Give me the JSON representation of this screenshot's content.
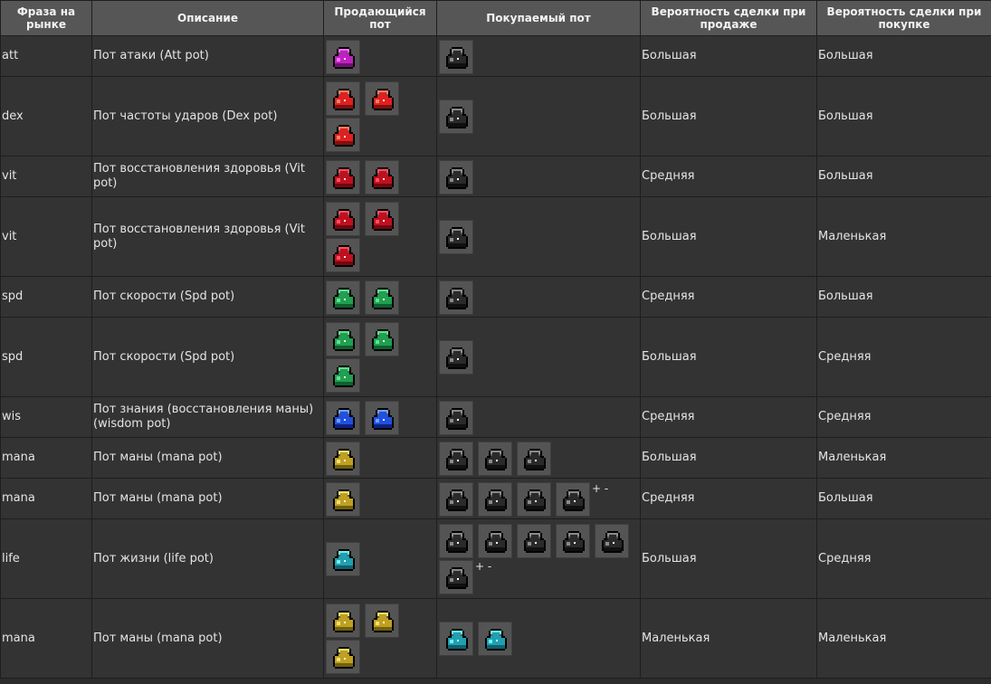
{
  "headers": [
    "Фраза на рынке",
    "Описание",
    "Продающийся пот",
    "Покупаемый пот",
    "Вероятность сделки при продаже",
    "Вероятность сделки при покупке"
  ],
  "rows": [
    {
      "phrase": "att",
      "desc": "Пот атаки (Att pot)",
      "sell": [
        "att-potion-icon"
      ],
      "buy": [
        "empty-potion-icon"
      ],
      "buy_note": "",
      "p_sell": "Большая",
      "p_buy": "Большая"
    },
    {
      "phrase": "dex",
      "desc": "Пот частоты ударов (Dex pot)",
      "sell": [
        "dex-potion-icon",
        "dex-potion-icon",
        "dex-potion-icon"
      ],
      "buy": [
        "empty-potion-icon"
      ],
      "buy_note": "",
      "p_sell": "Большая",
      "p_buy": "Большая"
    },
    {
      "phrase": "vit",
      "desc": "Пот восстановления здоровья (Vit pot)",
      "sell": [
        "vit-potion-icon",
        "vit-potion-icon"
      ],
      "buy": [
        "empty-potion-icon"
      ],
      "buy_note": "",
      "p_sell": "Средняя",
      "p_buy": "Большая"
    },
    {
      "phrase": "vit",
      "desc": "Пот восстановления здоровья (Vit pot)",
      "sell": [
        "vit-potion-icon",
        "vit-potion-icon",
        "vit-potion-icon"
      ],
      "buy": [
        "empty-potion-icon"
      ],
      "buy_note": "",
      "p_sell": "Большая",
      "p_buy": "Маленькая"
    },
    {
      "phrase": "spd",
      "desc": "Пот скорости (Spd pot)",
      "sell": [
        "spd-potion-icon",
        "spd-potion-icon"
      ],
      "buy": [
        "empty-potion-icon"
      ],
      "buy_note": "",
      "p_sell": "Средняя",
      "p_buy": "Большая"
    },
    {
      "phrase": "spd",
      "desc": "Пот скорости (Spd pot)",
      "sell": [
        "spd-potion-icon",
        "spd-potion-icon",
        "spd-potion-icon"
      ],
      "buy": [
        "empty-potion-icon"
      ],
      "buy_note": "",
      "p_sell": "Большая",
      "p_buy": "Средняя"
    },
    {
      "phrase": "wis",
      "desc": "Пот знания (восстановления маны) (wisdom pot)",
      "sell": [
        "wis-potion-icon",
        "wis-potion-icon"
      ],
      "buy": [
        "empty-potion-icon"
      ],
      "buy_note": "",
      "p_sell": "Средняя",
      "p_buy": "Средняя"
    },
    {
      "phrase": "mana",
      "desc": "Пот маны (mana pot)",
      "sell": [
        "mana-potion-icon"
      ],
      "buy": [
        "empty-potion-icon",
        "empty-potion-icon",
        "empty-potion-icon"
      ],
      "buy_note": "",
      "p_sell": "Большая",
      "p_buy": "Маленькая"
    },
    {
      "phrase": "mana",
      "desc": "Пот маны (mana pot)",
      "sell": [
        "mana-potion-icon"
      ],
      "buy": [
        "empty-potion-icon",
        "empty-potion-icon",
        "empty-potion-icon",
        "empty-potion-icon"
      ],
      "buy_note": "+ -",
      "p_sell": "Средняя",
      "p_buy": "Большая"
    },
    {
      "phrase": "life",
      "desc": "Пот жизни (life pot)",
      "sell": [
        "life-potion-icon"
      ],
      "buy": [
        "empty-potion-icon",
        "empty-potion-icon",
        "empty-potion-icon",
        "empty-potion-icon",
        "empty-potion-icon",
        "empty-potion-icon"
      ],
      "buy_note": "+ -",
      "p_sell": "Большая",
      "p_buy": "Средняя"
    },
    {
      "phrase": "mana",
      "desc": "Пот маны (mana pot)",
      "sell": [
        "mana-potion-icon",
        "mana-potion-icon",
        "mana-potion-icon"
      ],
      "buy": [
        "life-potion-icon",
        "life-potion-icon"
      ],
      "buy_note": "",
      "p_sell": "Маленькая",
      "p_buy": "Маленькая"
    }
  ],
  "potion_colors": {
    "att-potion-icon": {
      "main": "#c020c0",
      "light": "#f070f0",
      "dark": "#701070"
    },
    "dex-potion-icon": {
      "main": "#e02020",
      "light": "#ff8060",
      "dark": "#801010"
    },
    "vit-potion-icon": {
      "main": "#c01020",
      "light": "#ff5060",
      "dark": "#700810"
    },
    "spd-potion-icon": {
      "main": "#20a050",
      "light": "#60e090",
      "dark": "#106030"
    },
    "wis-potion-icon": {
      "main": "#2050e0",
      "light": "#70a0ff",
      "dark": "#102080"
    },
    "mana-potion-icon": {
      "main": "#c0a020",
      "light": "#f0e070",
      "dark": "#706010"
    },
    "life-potion-icon": {
      "main": "#20a0b0",
      "light": "#70f0f0",
      "dark": "#106070"
    },
    "empty-potion-icon": {
      "main": "#2a2a2a",
      "light": "#8a8a8a",
      "dark": "#101010"
    }
  }
}
